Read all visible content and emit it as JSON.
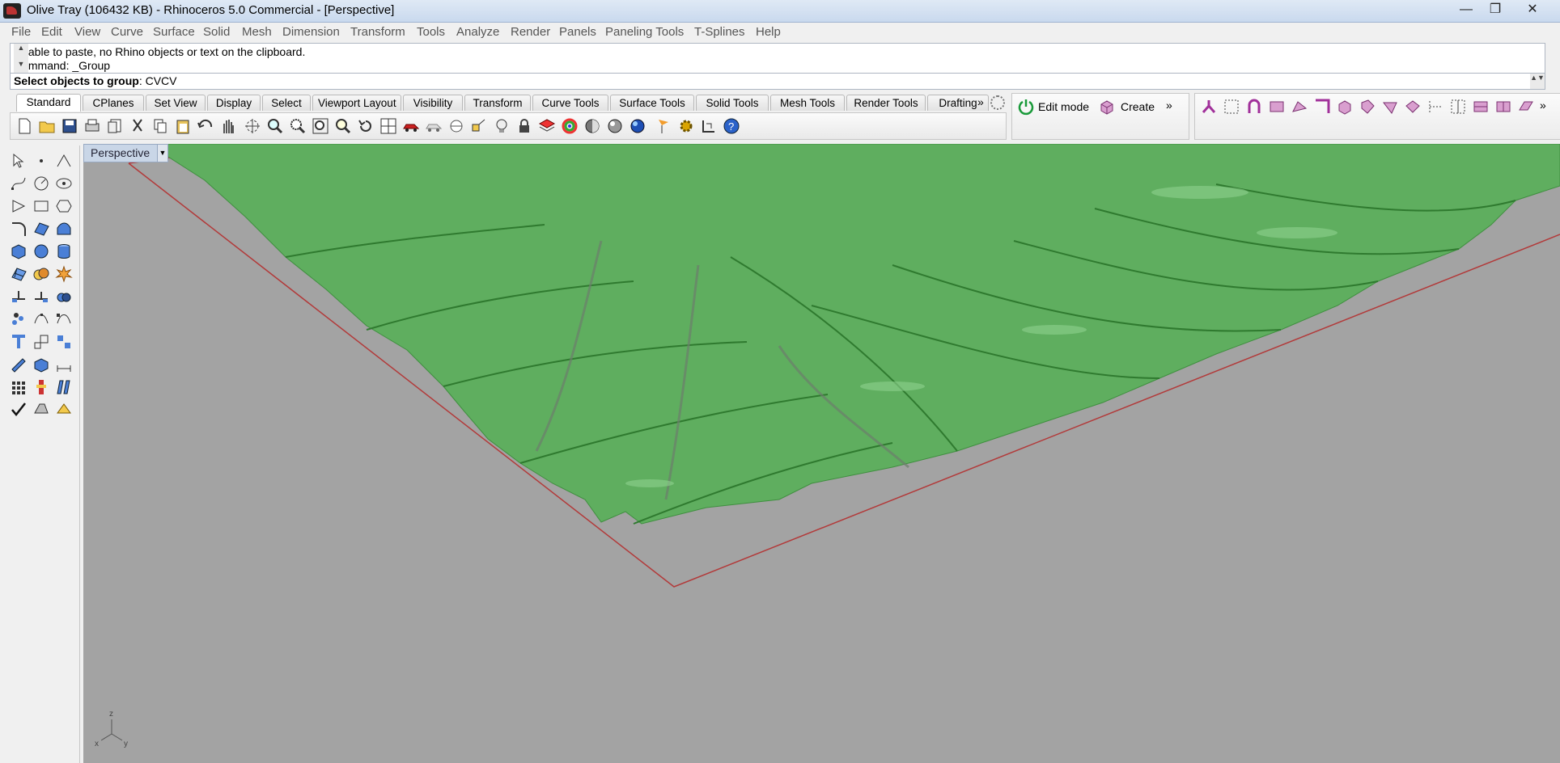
{
  "window": {
    "title": "Olive Tray (106432 KB) - Rhinoceros 5.0 Commercial - [Perspective]",
    "minimize": "—",
    "maximize": "❐",
    "close": "✕"
  },
  "menu": [
    "File",
    "Edit",
    "View",
    "Curve",
    "Surface",
    "Solid",
    "Mesh",
    "Dimension",
    "Transform",
    "Tools",
    "Analyze",
    "Render",
    "Panels",
    "Paneling Tools",
    "T-Splines",
    "Help"
  ],
  "command": {
    "history_line1": "Unable to paste, no Rhino objects or text on the clipboard.",
    "history_line2": "Command: _Group",
    "prompt_bold": "Select objects to group",
    "prompt_rest": ": CVCV"
  },
  "tabs": [
    "Standard",
    "CPlanes",
    "Set View",
    "Display",
    "Select",
    "Viewport Layout",
    "Visibility",
    "Transform",
    "Curve Tools",
    "Surface Tools",
    "Solid Tools",
    "Mesh Tools",
    "Render Tools",
    "Drafting"
  ],
  "active_tab": "Standard",
  "tsplines": {
    "edit_mode": "Edit mode",
    "create": "Create",
    "more": "»"
  },
  "viewport": {
    "name": "Perspective",
    "axis_z": "z",
    "axis_x": "x",
    "axis_y": "y",
    "surface_color": "#5fae5f",
    "background_color": "#a3a3a3",
    "grid_edge_color": "#b23a3a"
  }
}
